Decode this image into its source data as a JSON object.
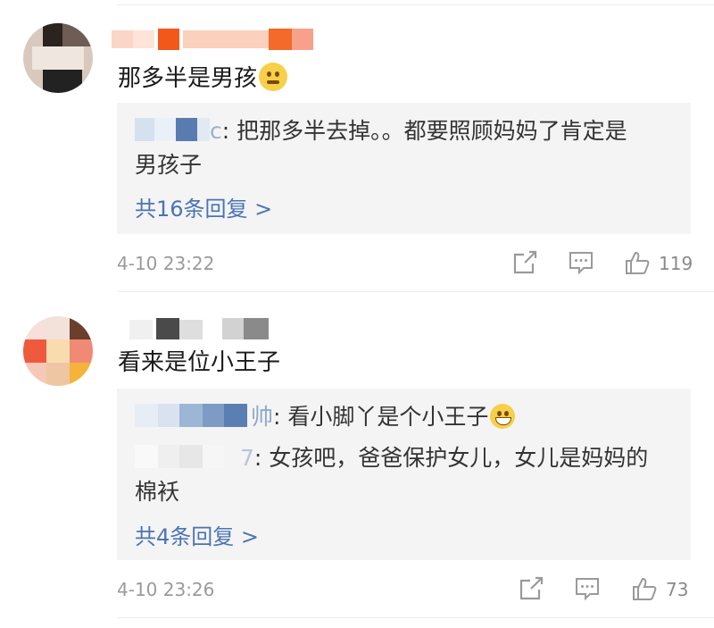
{
  "comments": [
    {
      "text": "那多半是男孩",
      "replies": [
        {
          "author_suffix": "c",
          "content": "把那多半去掉。。都要照顾妈妈了肯定是",
          "content_cont": "男孩子"
        }
      ],
      "more_replies": "共16条回复 >",
      "time": "4-10 23:22",
      "likes": "119"
    },
    {
      "text": "看来是位小王子",
      "replies": [
        {
          "author_suffix": "帅",
          "content": "看小脚丫是个小王子"
        },
        {
          "author_suffix": "7",
          "content": "女孩吧，爸爸保护女儿，女儿是妈妈的",
          "content_cont": "棉袄"
        }
      ],
      "more_replies": "共4条回复 >",
      "time": "4-10 23:26",
      "likes": "73"
    }
  ],
  "icons": {
    "share": "share-icon",
    "comment": "comment-icon",
    "like": "thumbs-up-icon",
    "emoji_1": "thinking-face-emoji",
    "emoji_2": "grinning-face-emoji"
  },
  "colors": {
    "link": "#4a74b4",
    "reply_bg": "#f4f4f4",
    "meta": "#9a9a9a"
  }
}
